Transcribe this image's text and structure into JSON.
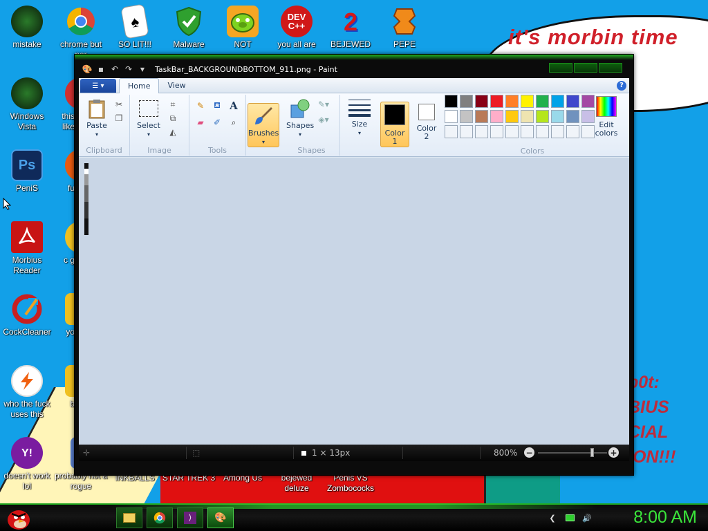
{
  "wallpaper": {
    "bubble_text": "it's morbin time",
    "right_text_lines": [
      "b0t:",
      "BIUS",
      "CIAL",
      "ION!!!"
    ]
  },
  "desktop_icons": [
    {
      "label": "mistake",
      "icon": "dark-green-orb-icon",
      "color": "#1a3a1a"
    },
    {
      "label": "chrome but nor",
      "icon": "chrome-icon",
      "color": "#ffffff"
    },
    {
      "label": "SO LIT!!!",
      "icon": "playing-card-icon",
      "color": "#ffffff"
    },
    {
      "label": "Malware",
      "icon": "green-shield-icon",
      "color": "#2a9a2a"
    },
    {
      "label": "NOT",
      "icon": "green-pig-icon",
      "color": "#f5a623"
    },
    {
      "label": "you all are",
      "icon": "dev-cpp-icon",
      "color": "#d01818"
    },
    {
      "label": "BEJEWED",
      "icon": "red-2-icon",
      "color": "#1446c8"
    },
    {
      "label": "PEPE",
      "icon": "orange-gem-icon",
      "color": "#e07a10"
    },
    {
      "label": "Windows Vista",
      "icon": "dark-green-orb-icon",
      "color": "#1a3a1a"
    },
    {
      "label": "this like",
      "icon": "red-circle-icon",
      "color": "#d03030"
    },
    {
      "label": "PeniS",
      "icon": "photoshop-icon",
      "color": "#0f2a5a"
    },
    {
      "label": "fu",
      "icon": "firefox-icon",
      "color": "#e85a10"
    },
    {
      "label": "Morbius Reader",
      "icon": "acrobat-icon",
      "color": "#c81414"
    },
    {
      "label": "c g",
      "icon": "yellow-icon",
      "color": "#f0c020"
    },
    {
      "label": "CockCleaner",
      "icon": "ccleaner-icon",
      "color": "#c82020"
    },
    {
      "label": "yo",
      "icon": "yellow-icon",
      "color": "#f0c020"
    },
    {
      "label": "who the fuck uses this",
      "icon": "lightning-icon",
      "color": "#ffffff"
    },
    {
      "label": "b",
      "icon": "yellow-icon",
      "color": "#f0c020"
    },
    {
      "label": "doesn't work lol",
      "icon": "yahoo-messenger-icon",
      "color": "#7a1ca0"
    },
    {
      "label": "probably not a rogue",
      "icon": "document-icon",
      "color": "#5a80d0"
    },
    {
      "label": "INKBALLS",
      "icon": "",
      "color": ""
    },
    {
      "label": "STAR TREK 3",
      "icon": "",
      "color": ""
    },
    {
      "label": "Among Us",
      "icon": "",
      "color": ""
    },
    {
      "label": "bejewed deluze",
      "icon": "",
      "color": ""
    },
    {
      "label": "Penis VS Zombococks",
      "icon": "",
      "color": ""
    }
  ],
  "paint": {
    "title": "TaskBar_BACKGROUNDBOTTOM_911.png - Paint",
    "tabs": [
      "Home",
      "View"
    ],
    "groups": {
      "clipboard": "Clipboard",
      "image": "Image",
      "tools": "Tools",
      "shapes": "Shapes",
      "colors": "Colors"
    },
    "buttons": {
      "paste": "Paste",
      "select": "Select",
      "brushes": "Brushes",
      "shapes": "Shapes",
      "size": "Size",
      "color1_line1": "Color",
      "color1_line2": "1",
      "color2_line1": "Color",
      "color2_line2": "2",
      "edit_colors_line1": "Edit",
      "edit_colors_line2": "colors"
    },
    "color1": "#000000",
    "color2": "#ffffff",
    "palette_row1": [
      "#000000",
      "#7f7f7f",
      "#880015",
      "#ed1c24",
      "#ff7f27",
      "#fff200",
      "#22b14c",
      "#00a2e8",
      "#3f48cc",
      "#a349a4"
    ],
    "palette_row2": [
      "#ffffff",
      "#c3c3c3",
      "#b97a57",
      "#ffaec9",
      "#ffc90e",
      "#efe4b0",
      "#b5e61d",
      "#99d9ea",
      "#7092be",
      "#c8bfe7"
    ],
    "palette_row3": [
      "#f0f4f9",
      "#f0f4f9",
      "#f0f4f9",
      "#f0f4f9",
      "#f0f4f9",
      "#f0f4f9",
      "#f0f4f9",
      "#f0f4f9",
      "#f0f4f9",
      "#f0f4f9"
    ],
    "status": {
      "image_size": "1 × 13px",
      "zoom": "800%"
    }
  },
  "taskbar": {
    "clock": "8:00 AM",
    "buttons": [
      "explorer-folder-icon",
      "chrome-icon",
      "visual-studio-icon",
      "paint-icon"
    ]
  }
}
